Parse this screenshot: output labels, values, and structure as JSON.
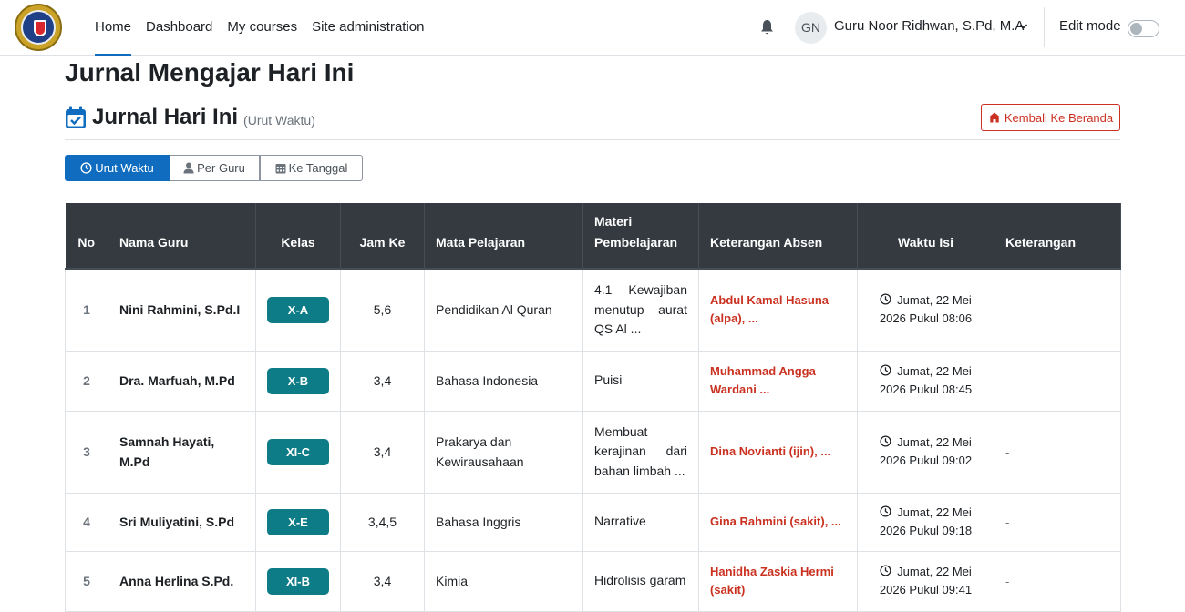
{
  "navbar": {
    "links": [
      "Home",
      "Dashboard",
      "My courses",
      "Site administration"
    ],
    "active_link": "Home",
    "avatar_initials": "GN",
    "user_name": "Guru Noor Ridhwan, S.Pd, M.A",
    "edit_mode_label": "Edit mode",
    "edit_mode_on": false
  },
  "page": {
    "title": "Jurnal Mengajar Hari Ini",
    "subtitle": "Jurnal Hari Ini",
    "subtitle_note": "(Urut Waktu)",
    "back_button": "Kembali Ke Beranda",
    "view_buttons": [
      "Urut Waktu",
      "Per Guru",
      "Ke Tanggal"
    ],
    "active_view": "Urut Waktu"
  },
  "table": {
    "headers": {
      "no": "No",
      "guru": "Nama Guru",
      "kelas": "Kelas",
      "jam": "Jam Ke",
      "mapel": "Mata Pelajaran",
      "materi": "Materi Pembelajaran",
      "absen": "Keterangan Absen",
      "waktu": "Waktu Isi",
      "ket": "Keterangan"
    },
    "rows": [
      {
        "no": "1",
        "guru": "Nini Rahmini, S.Pd.I",
        "kelas": "X-A",
        "jam": "5,6",
        "mapel": "Pendidikan Al Quran",
        "materi": "4.1 Kewajiban menutup aurat QS Al ...",
        "absen": "Abdul Kamal Hasuna (alpa), ...",
        "waktu_1": "Jumat, 22 Mei",
        "waktu_2": "2026 Pukul 08:06",
        "ket": "-"
      },
      {
        "no": "2",
        "guru": "Dra. Marfuah, M.Pd",
        "kelas": "X-B",
        "jam": "3,4",
        "mapel": "Bahasa Indonesia",
        "materi": "Puisi",
        "absen": "Muhammad Angga Wardani ...",
        "waktu_1": "Jumat, 22 Mei",
        "waktu_2": "2026 Pukul 08:45",
        "ket": "-"
      },
      {
        "no": "3",
        "guru": "Samnah Hayati, M.Pd",
        "kelas": "XI-C",
        "jam": "3,4",
        "mapel": "Prakarya dan Kewirausahaan",
        "materi": "Membuat kerajinan dari bahan limbah ...",
        "absen": "Dina Novianti (ijin), ...",
        "waktu_1": "Jumat, 22 Mei",
        "waktu_2": "2026 Pukul 09:02",
        "ket": "-"
      },
      {
        "no": "4",
        "guru": "Sri Muliyatini, S.Pd",
        "kelas": "X-E",
        "jam": "3,4,5",
        "mapel": "Bahasa Inggris",
        "materi": "Narrative",
        "absen": "Gina Rahmini (sakit), ...",
        "waktu_1": "Jumat, 22 Mei",
        "waktu_2": "2026 Pukul 09:18",
        "ket": "-"
      },
      {
        "no": "5",
        "guru": "Anna Herlina S.Pd.",
        "kelas": "XI-B",
        "jam": "3,4",
        "mapel": "Kimia",
        "materi": "Hidrolisis garam",
        "absen": "Hanidha Zaskia Hermi (sakit)",
        "waktu_1": "Jumat, 22 Mei",
        "waktu_2": "2026 Pukul 09:41",
        "ket": "-"
      }
    ]
  },
  "colors": {
    "primary": "#0f6cbf",
    "danger": "#ca3120",
    "kelas_badge": "#0e7c86",
    "table_header": "#343a40"
  }
}
